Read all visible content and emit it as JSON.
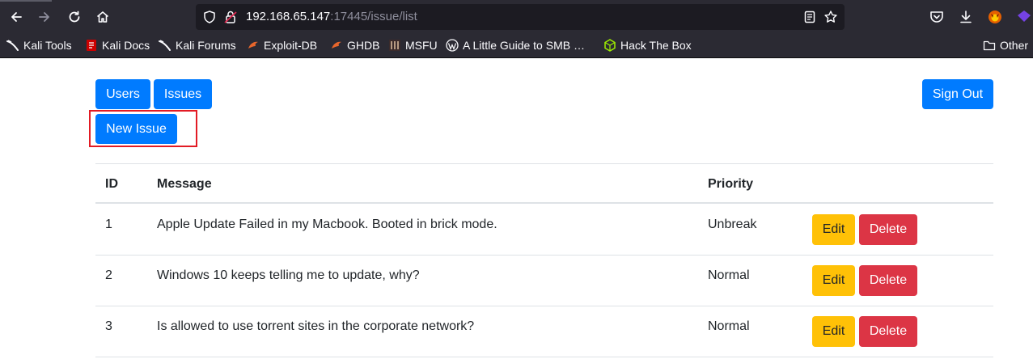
{
  "browser": {
    "url_host": "192.168.65.147",
    "url_path": ":17445/issue/list",
    "bookmarks": [
      {
        "label": "Kali Tools",
        "icon": "kali-dragon-icon"
      },
      {
        "label": "Kali Docs",
        "icon": "kali-docs-icon"
      },
      {
        "label": "Kali Forums",
        "icon": "kali-dragon-icon"
      },
      {
        "label": "Exploit-DB",
        "icon": "exploit-db-icon"
      },
      {
        "label": "GHDB",
        "icon": "exploit-db-icon"
      },
      {
        "label": "MSFU",
        "icon": "msfu-icon"
      },
      {
        "label": "A Little Guide to SMB …",
        "icon": "wordpress-icon"
      },
      {
        "label": "Hack The Box",
        "icon": "hackthebox-icon"
      }
    ],
    "other_bookmarks": "Other",
    "colors": {
      "chrome": "#2b2a33",
      "urlbar": "#1c1b22"
    }
  },
  "nav": {
    "users_label": "Users",
    "issues_label": "Issues",
    "signout_label": "Sign Out",
    "new_issue_label": "New Issue"
  },
  "table": {
    "columns": {
      "id": "ID",
      "message": "Message",
      "priority": "Priority"
    },
    "rows": [
      {
        "id": "1",
        "message": "Apple Update Failed in my Macbook. Booted in brick mode.",
        "priority": "Unbreak",
        "edit": "Edit",
        "delete": "Delete"
      },
      {
        "id": "2",
        "message": "Windows 10 keeps telling me to update, why?",
        "priority": "Normal",
        "edit": "Edit",
        "delete": "Delete"
      },
      {
        "id": "3",
        "message": "Is allowed to use torrent sites in the corporate network?",
        "priority": "Normal",
        "edit": "Edit",
        "delete": "Delete"
      }
    ]
  },
  "colors": {
    "primary": "#007bff",
    "warning": "#ffc107",
    "danger": "#dc3545",
    "highlight": "#e21b24"
  }
}
